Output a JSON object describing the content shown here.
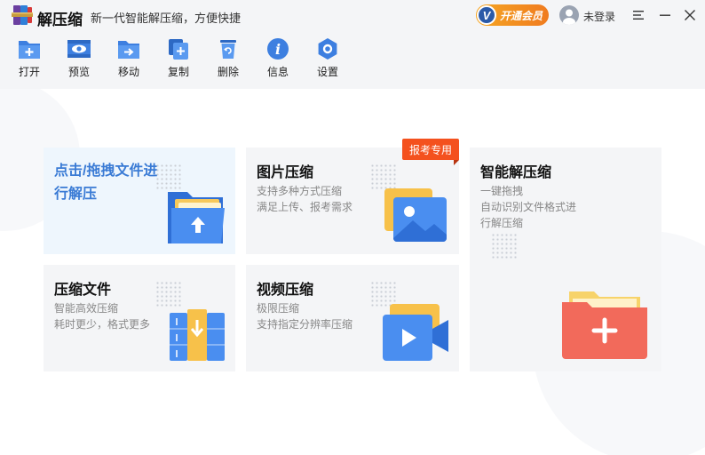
{
  "titlebar": {
    "app_title": "解压缩",
    "slogan": "新一代智能解压缩，方便快捷",
    "vip_label": "开通会员",
    "vip_letter": "V",
    "login_label": "未登录"
  },
  "toolbar": {
    "items": [
      {
        "label": "打开",
        "icon": "folder-plus-icon"
      },
      {
        "label": "预览",
        "icon": "eye-icon"
      },
      {
        "label": "移动",
        "icon": "folder-arrow-icon"
      },
      {
        "label": "复制",
        "icon": "copy-icon"
      },
      {
        "label": "删除",
        "icon": "trash-icon"
      },
      {
        "label": "信息",
        "icon": "info-icon"
      },
      {
        "label": "设置",
        "icon": "gear-icon"
      }
    ]
  },
  "cards": {
    "drop": {
      "title": "点击/拖拽文件进行解压"
    },
    "image": {
      "title": "图片压缩",
      "desc1": "支持多种方式压缩",
      "desc2": "满足上传、报考需求",
      "tag": "报考专用"
    },
    "smart": {
      "title": "智能解压缩",
      "desc1": "一键拖拽",
      "desc2": "自动识别文件格式进",
      "desc3": "行解压缩"
    },
    "compress": {
      "title": "压缩文件",
      "desc1": "智能高效压缩",
      "desc2": "耗时更少，格式更多"
    },
    "video": {
      "title": "视频压缩",
      "desc1": "极限压缩",
      "desc2": "支持指定分辨率压缩"
    }
  },
  "colors": {
    "accent_blue": "#3a7bd5",
    "tag_red": "#f4511e",
    "vip_orange": "#f5a623"
  }
}
